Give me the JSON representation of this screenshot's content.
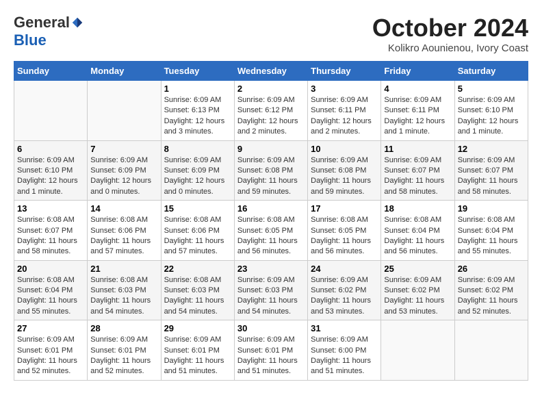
{
  "header": {
    "logo": {
      "general": "General",
      "blue": "Blue"
    },
    "title": "October 2024",
    "location": "Kolikro Aounienou, Ivory Coast"
  },
  "weekdays": [
    "Sunday",
    "Monday",
    "Tuesday",
    "Wednesday",
    "Thursday",
    "Friday",
    "Saturday"
  ],
  "weeks": [
    [
      {
        "day": "",
        "info": ""
      },
      {
        "day": "",
        "info": ""
      },
      {
        "day": "1",
        "info": "Sunrise: 6:09 AM\nSunset: 6:13 PM\nDaylight: 12 hours\nand 3 minutes."
      },
      {
        "day": "2",
        "info": "Sunrise: 6:09 AM\nSunset: 6:12 PM\nDaylight: 12 hours\nand 2 minutes."
      },
      {
        "day": "3",
        "info": "Sunrise: 6:09 AM\nSunset: 6:11 PM\nDaylight: 12 hours\nand 2 minutes."
      },
      {
        "day": "4",
        "info": "Sunrise: 6:09 AM\nSunset: 6:11 PM\nDaylight: 12 hours\nand 1 minute."
      },
      {
        "day": "5",
        "info": "Sunrise: 6:09 AM\nSunset: 6:10 PM\nDaylight: 12 hours\nand 1 minute."
      }
    ],
    [
      {
        "day": "6",
        "info": "Sunrise: 6:09 AM\nSunset: 6:10 PM\nDaylight: 12 hours\nand 1 minute."
      },
      {
        "day": "7",
        "info": "Sunrise: 6:09 AM\nSunset: 6:09 PM\nDaylight: 12 hours\nand 0 minutes."
      },
      {
        "day": "8",
        "info": "Sunrise: 6:09 AM\nSunset: 6:09 PM\nDaylight: 12 hours\nand 0 minutes."
      },
      {
        "day": "9",
        "info": "Sunrise: 6:09 AM\nSunset: 6:08 PM\nDaylight: 11 hours\nand 59 minutes."
      },
      {
        "day": "10",
        "info": "Sunrise: 6:09 AM\nSunset: 6:08 PM\nDaylight: 11 hours\nand 59 minutes."
      },
      {
        "day": "11",
        "info": "Sunrise: 6:09 AM\nSunset: 6:07 PM\nDaylight: 11 hours\nand 58 minutes."
      },
      {
        "day": "12",
        "info": "Sunrise: 6:09 AM\nSunset: 6:07 PM\nDaylight: 11 hours\nand 58 minutes."
      }
    ],
    [
      {
        "day": "13",
        "info": "Sunrise: 6:08 AM\nSunset: 6:07 PM\nDaylight: 11 hours\nand 58 minutes."
      },
      {
        "day": "14",
        "info": "Sunrise: 6:08 AM\nSunset: 6:06 PM\nDaylight: 11 hours\nand 57 minutes."
      },
      {
        "day": "15",
        "info": "Sunrise: 6:08 AM\nSunset: 6:06 PM\nDaylight: 11 hours\nand 57 minutes."
      },
      {
        "day": "16",
        "info": "Sunrise: 6:08 AM\nSunset: 6:05 PM\nDaylight: 11 hours\nand 56 minutes."
      },
      {
        "day": "17",
        "info": "Sunrise: 6:08 AM\nSunset: 6:05 PM\nDaylight: 11 hours\nand 56 minutes."
      },
      {
        "day": "18",
        "info": "Sunrise: 6:08 AM\nSunset: 6:04 PM\nDaylight: 11 hours\nand 56 minutes."
      },
      {
        "day": "19",
        "info": "Sunrise: 6:08 AM\nSunset: 6:04 PM\nDaylight: 11 hours\nand 55 minutes."
      }
    ],
    [
      {
        "day": "20",
        "info": "Sunrise: 6:08 AM\nSunset: 6:04 PM\nDaylight: 11 hours\nand 55 minutes."
      },
      {
        "day": "21",
        "info": "Sunrise: 6:08 AM\nSunset: 6:03 PM\nDaylight: 11 hours\nand 54 minutes."
      },
      {
        "day": "22",
        "info": "Sunrise: 6:08 AM\nSunset: 6:03 PM\nDaylight: 11 hours\nand 54 minutes."
      },
      {
        "day": "23",
        "info": "Sunrise: 6:09 AM\nSunset: 6:03 PM\nDaylight: 11 hours\nand 54 minutes."
      },
      {
        "day": "24",
        "info": "Sunrise: 6:09 AM\nSunset: 6:02 PM\nDaylight: 11 hours\nand 53 minutes."
      },
      {
        "day": "25",
        "info": "Sunrise: 6:09 AM\nSunset: 6:02 PM\nDaylight: 11 hours\nand 53 minutes."
      },
      {
        "day": "26",
        "info": "Sunrise: 6:09 AM\nSunset: 6:02 PM\nDaylight: 11 hours\nand 52 minutes."
      }
    ],
    [
      {
        "day": "27",
        "info": "Sunrise: 6:09 AM\nSunset: 6:01 PM\nDaylight: 11 hours\nand 52 minutes."
      },
      {
        "day": "28",
        "info": "Sunrise: 6:09 AM\nSunset: 6:01 PM\nDaylight: 11 hours\nand 52 minutes."
      },
      {
        "day": "29",
        "info": "Sunrise: 6:09 AM\nSunset: 6:01 PM\nDaylight: 11 hours\nand 51 minutes."
      },
      {
        "day": "30",
        "info": "Sunrise: 6:09 AM\nSunset: 6:01 PM\nDaylight: 11 hours\nand 51 minutes."
      },
      {
        "day": "31",
        "info": "Sunrise: 6:09 AM\nSunset: 6:00 PM\nDaylight: 11 hours\nand 51 minutes."
      },
      {
        "day": "",
        "info": ""
      },
      {
        "day": "",
        "info": ""
      }
    ]
  ]
}
